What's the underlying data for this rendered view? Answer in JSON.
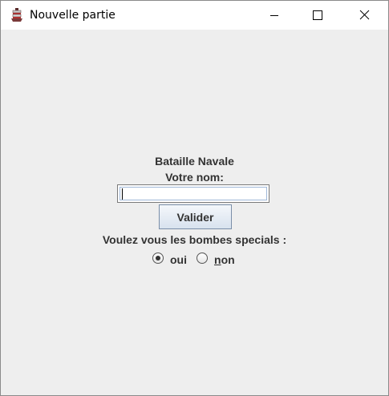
{
  "window": {
    "title": "Nouvelle partie",
    "icon": "ship-icon",
    "controls": [
      "minimize-icon",
      "maximize-icon",
      "close-icon"
    ]
  },
  "form": {
    "heading": "Bataille Navale",
    "name_label": "Votre nom:",
    "name_value": "",
    "submit_label": "Valider",
    "bombs_question": "Voulez vous les bombes specials :",
    "options": [
      {
        "label_first": "",
        "label_rest": "oui",
        "selected": true
      },
      {
        "label_first": "n",
        "label_rest": "on",
        "selected": false
      }
    ]
  }
}
